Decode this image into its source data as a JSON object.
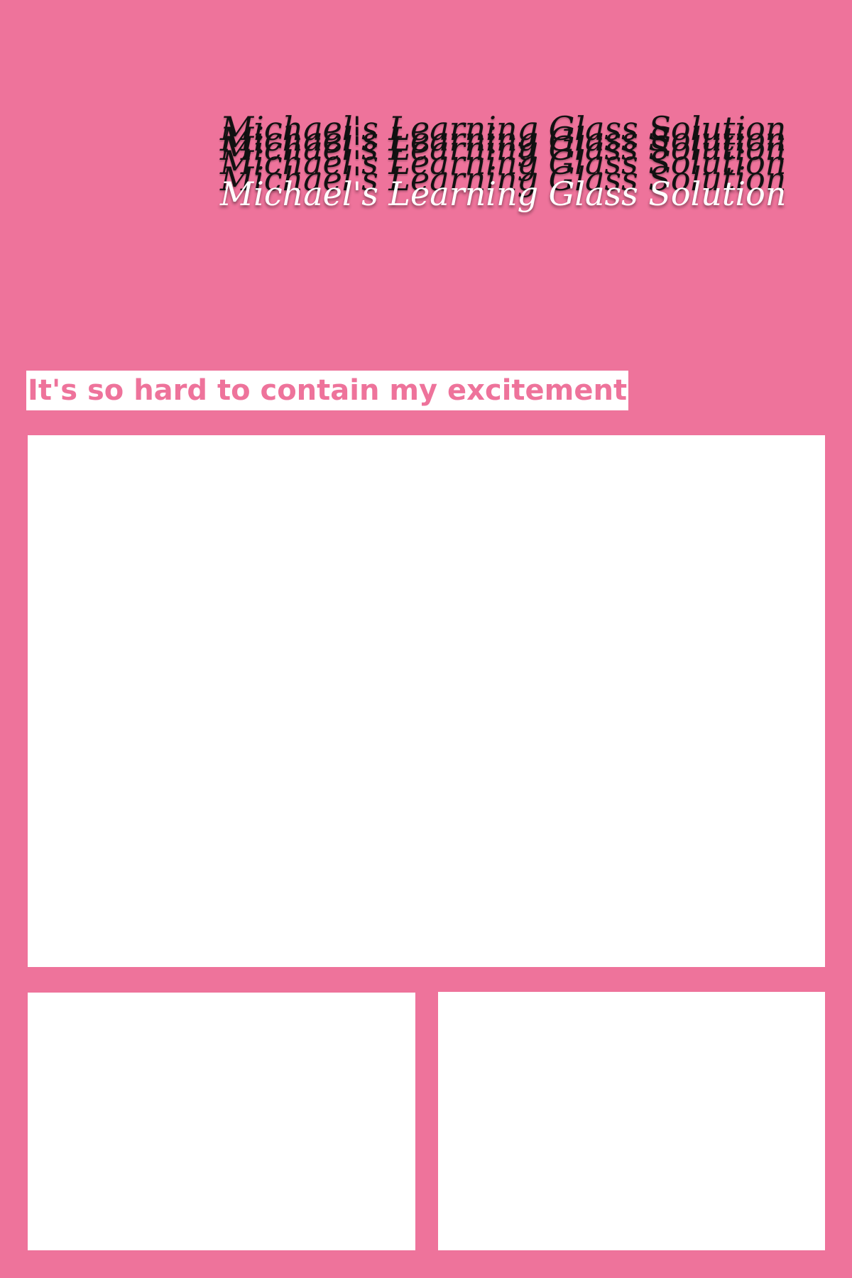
{
  "colors": {
    "background": "#EE739B",
    "accent": "#EE739B",
    "panel": "#FFFFFF",
    "logo_dark": "#111111",
    "logo_light": "#FFFFFF"
  },
  "logo": {
    "text": "Michael's Learning Glass Solution"
  },
  "hero": {
    "heading": "It's so hard to contain my excitement"
  }
}
